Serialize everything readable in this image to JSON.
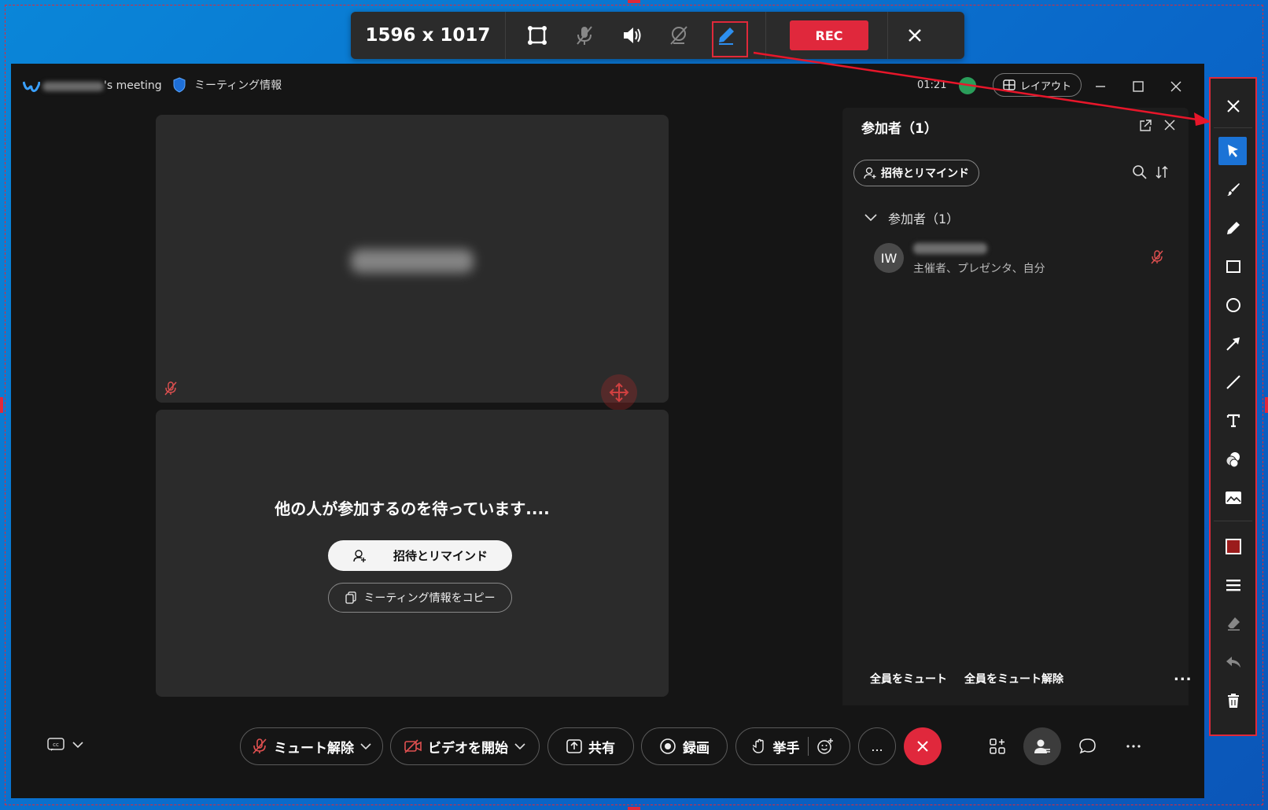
{
  "capture_toolbar": {
    "size_label": "1596 x 1017",
    "rec_label": "REC",
    "icons": [
      "region-icon",
      "mic-off-icon",
      "speaker-icon",
      "camera-off-icon",
      "pen-icon",
      "close-icon"
    ]
  },
  "window": {
    "title_suffix": "'s meeting",
    "info_label": "ミーティング情報",
    "time": "01:21",
    "layout_label": "レイアウト"
  },
  "tile1": {},
  "tile2": {
    "waiting_text": "他の人が参加するのを待っています....",
    "invite_label": "招待とリマインド",
    "copy_label": "ミーティング情報をコピー"
  },
  "panel": {
    "title": "参加者（1）",
    "invite_label": "招待とリマインド",
    "group_label": "参加者（1）",
    "participants": [
      {
        "initials": "IW",
        "role": "主催者、プレゼンタ、自分"
      }
    ],
    "mute_all": "全員をミュート",
    "unmute_all": "全員をミュート解除",
    "more": "..."
  },
  "controls": {
    "unmute_label": "ミュート解除",
    "video_label": "ビデオを開始",
    "share_label": "共有",
    "record_label": "録画",
    "raise_hand_label": "挙手",
    "more_label": "..."
  },
  "colors": {
    "accent_red": "#e0293a",
    "selected_blue": "#1b73d6",
    "background_blue": "#0a86d8",
    "swatch": "#9b1c1c"
  }
}
